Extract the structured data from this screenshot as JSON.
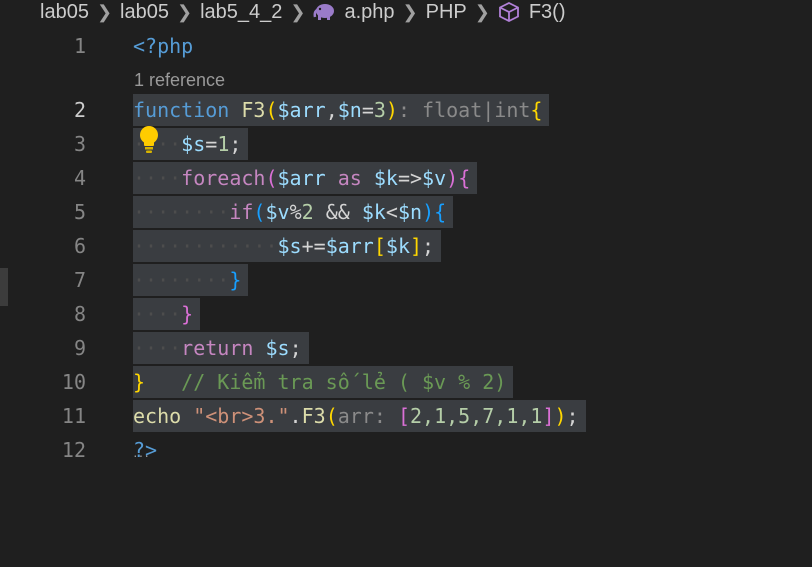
{
  "breadcrumb": {
    "items": [
      "lab05",
      "lab05",
      "lab5_4_2",
      "a.php",
      "PHP",
      "F3()"
    ],
    "icons": [
      "php-elephant-icon",
      "method-cube-icon"
    ]
  },
  "editor": {
    "codelens": "1 reference",
    "active_line": 2,
    "line_numbers": [
      "1",
      "2",
      "3",
      "4",
      "5",
      "6",
      "7",
      "8",
      "9",
      "10",
      "11",
      "12"
    ],
    "tokens": {
      "l1_open": "<?php",
      "l2_function": "function",
      "l2_name": "F3",
      "l2_lp": "(",
      "l2_arr": "$arr",
      "l2_comma": ",",
      "l2_n": "$n",
      "l2_eq": "=",
      "l2_three": "3",
      "l2_rp": ")",
      "l2_hint": ": float|int",
      "l2_brace": "{",
      "l3_s": "$s",
      "l3_eq": "=",
      "l3_one": "1",
      "l3_semi": ";",
      "l4_foreach": "foreach",
      "l4_lp": "(",
      "l4_arr": "$arr",
      "l4_as": " as ",
      "l4_k": "$k",
      "l4_arrow": "=>",
      "l4_v": "$v",
      "l4_rp": ")",
      "l4_brace": "{",
      "l5_if": "if",
      "l5_lp": "(",
      "l5_v": "$v",
      "l5_mod": "%",
      "l5_two": "2",
      "l5_and": " && ",
      "l5_k": "$k",
      "l5_lt": "<",
      "l5_n": "$n",
      "l5_rp": ")",
      "l5_brace": "{",
      "l6_s": "$s",
      "l6_op": "+=",
      "l6_arr": "$arr",
      "l6_lb": "[",
      "l6_k": "$k",
      "l6_rb": "]",
      "l6_semi": ";",
      "l7_brace": "}",
      "l8_brace": "}",
      "l9_return": "return",
      "l9_s": "$s",
      "l9_semi": ";",
      "l10_brace": "}",
      "l10_comment": "// Kiểm tra số lẻ ( $v % 2)",
      "l11_echo": "echo ",
      "l11_str": "\"<br>3.\"",
      "l11_dot": ".",
      "l11_fn": "F3",
      "l11_lp": "(",
      "l11_hint": "arr: ",
      "l11_lb": "[",
      "l11_nums": "2,1,5,7,1,1",
      "l11_rb": "]",
      "l11_rp": ")",
      "l11_semi": ";",
      "l12_close": "?>"
    }
  },
  "colors": {
    "background": "#1f1f1f",
    "selection": "#3a3d41",
    "keyword": "#569cd6",
    "control": "#c586c0",
    "function": "#dcdcaa",
    "variable": "#9cdcfe",
    "number": "#b5cea8",
    "string": "#ce9178",
    "comment": "#6a9955",
    "bracket_gold": "#ffd700",
    "bracket_pink": "#da70d6",
    "bracket_blue": "#179fff"
  }
}
